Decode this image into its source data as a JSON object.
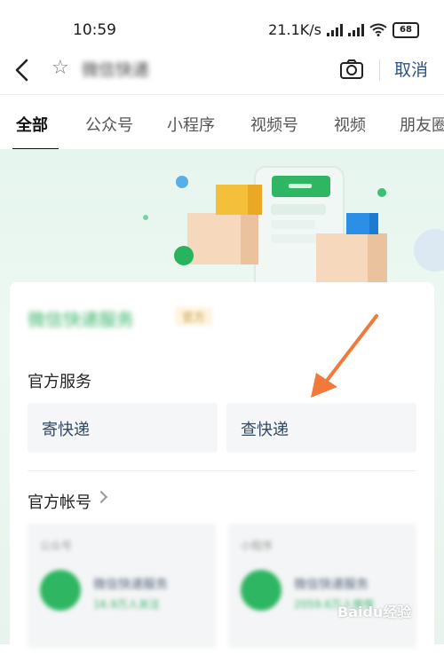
{
  "status_bar": {
    "time": "10:59",
    "net_speed": "21.1K/s",
    "battery": "68"
  },
  "header": {
    "query": "微信快递",
    "cancel_label": "取消"
  },
  "tabs": [
    {
      "label": "全部"
    },
    {
      "label": "公众号"
    },
    {
      "label": "小程序"
    },
    {
      "label": "视频号"
    },
    {
      "label": "视频"
    },
    {
      "label": "朋友圈"
    }
  ],
  "card": {
    "title": "微信快递服务",
    "tag": "官方",
    "official_services": {
      "label": "官方服务",
      "buttons": [
        {
          "label": "寄快递"
        },
        {
          "label": "查快递"
        }
      ]
    },
    "official_accounts": {
      "label": "官方帐号",
      "items": [
        {
          "kind": "公众号",
          "name": "微信快递服务",
          "sub": "16.9万人关注"
        },
        {
          "kind": "小程序",
          "name": "微信快递服务",
          "sub": "2059.6万人使用"
        }
      ]
    }
  },
  "watermark": "Baidu经验",
  "colors": {
    "accent_green": "#38b36a",
    "link_blue": "#2d5284",
    "arrow_orange": "#f07a3c"
  }
}
